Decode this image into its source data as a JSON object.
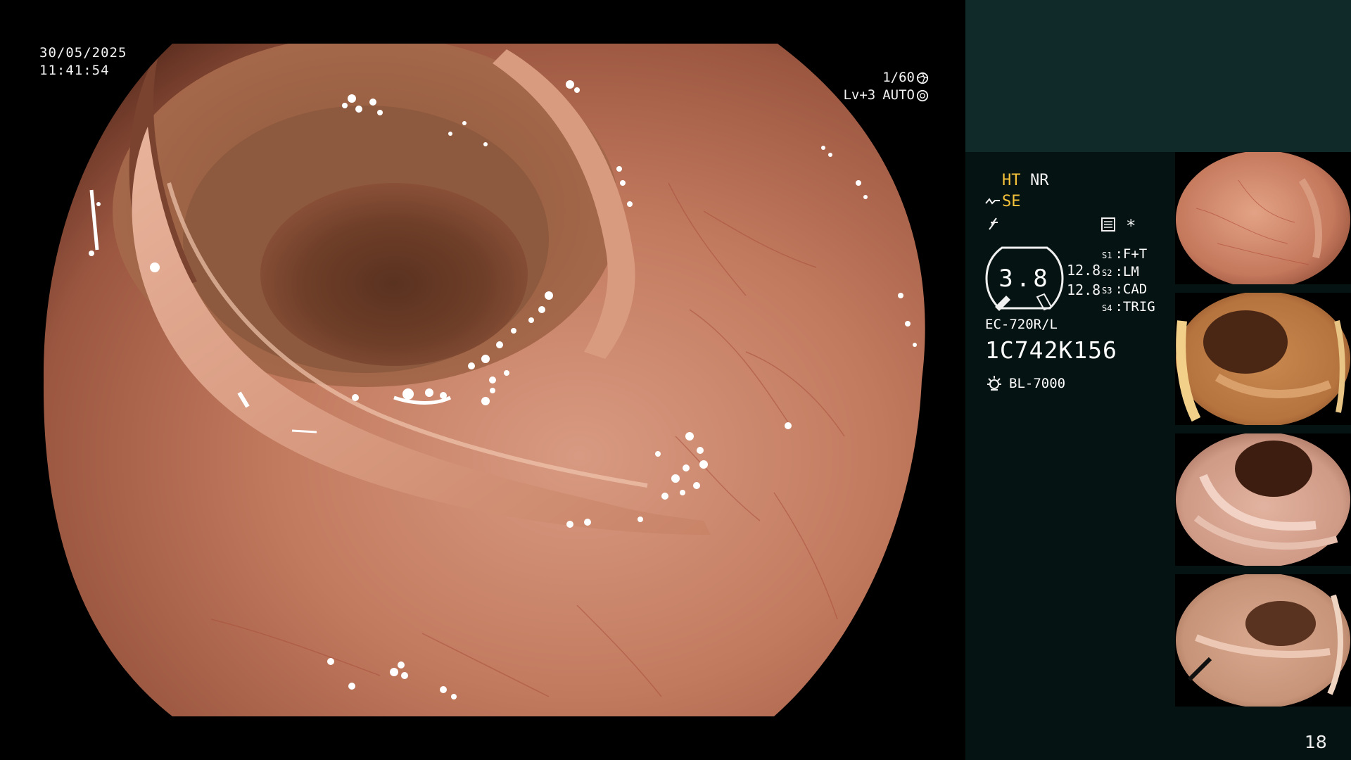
{
  "osd": {
    "date": "30/05/2025",
    "time": "11:41:54",
    "shutter": "1/60",
    "level": "Lv+3",
    "mode": "AUTO"
  },
  "status": {
    "ht": "HT",
    "nr": "NR",
    "se": "SE",
    "asterisk": "*",
    "gauge_value": "3.8",
    "gauge_side_1": "12.8",
    "gauge_side_2": "12.8",
    "switches": [
      {
        "key": "S1",
        "value": "F+T"
      },
      {
        "key": "S2",
        "value": "LM"
      },
      {
        "key": "S3",
        "value": "CAD"
      },
      {
        "key": "S4",
        "value": "TRIG"
      }
    ],
    "scope_model": "EC-720R/L",
    "scope_serial": "1C742K156",
    "light_source": "BL-7000"
  },
  "page_number": "18",
  "colors": {
    "side_panel": "#061313",
    "side_top": "#0f2a28",
    "highlight": "#f6c33a"
  },
  "icons": [
    "shutter-icon",
    "iris-icon",
    "se-wave-icon",
    "sharpness-icon",
    "structure-icon",
    "light-source-icon"
  ]
}
